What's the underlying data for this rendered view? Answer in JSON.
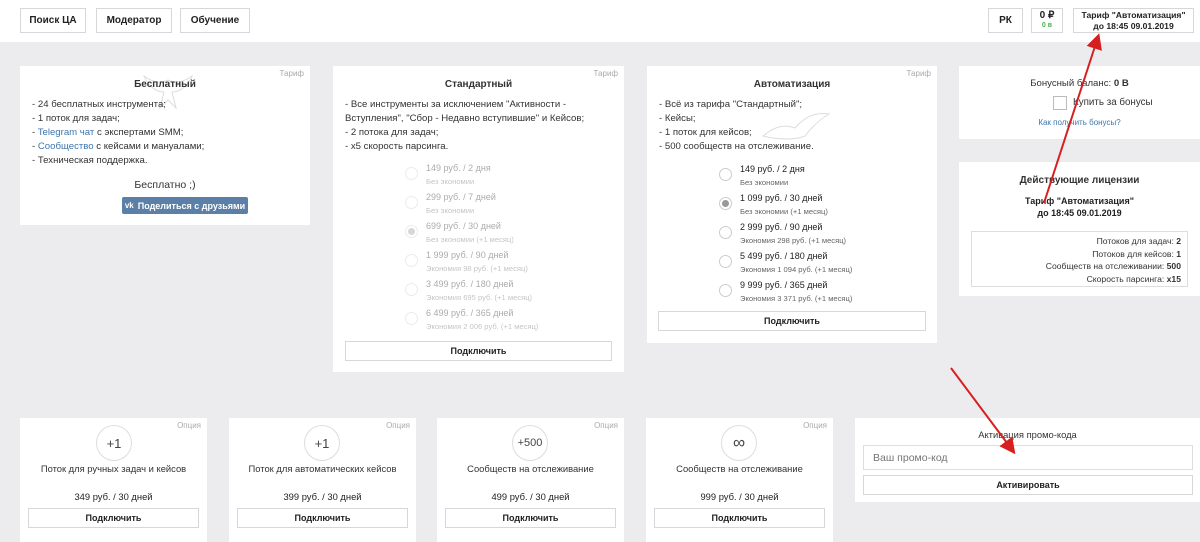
{
  "top_nav": {
    "search_ca": "Поиск ЦА",
    "moderator": "Модератор",
    "learning": "Обучение",
    "rk": "РК",
    "balance_amount": "0 ₽",
    "balance_bonus": "0 в",
    "tariff_name": "Тариф \"Автоматизация\"",
    "tariff_until": "до 18:45 09.01.2019"
  },
  "tariff_tag": "Тариф",
  "option_tag": "Опция",
  "connect_label": "Подключить",
  "free_plan": {
    "title": "Бесплатный",
    "line1": "- 24 бесплатных инструмента;",
    "line2": "- 1 поток для задач;",
    "line3_pre": "- ",
    "line3_link": "Telegram чат",
    "line3_post": " с экспертами SMM;",
    "line4_pre": "- ",
    "line4_link": "Сообщество",
    "line4_post": " с кейсами и мануалами;",
    "line5": "- Техническая поддержка.",
    "price": "Бесплатно ;)",
    "share_label": "Поделиться с друзьями",
    "share_icon": "vk-icon"
  },
  "standard_plan": {
    "title": "Стандартный",
    "lines": [
      "- Все инструменты за исключением \"Активности -",
      "Вступления\", \"Сбор - Недавно вступившие\" и Кейсов;",
      "- 2 потока для задач;",
      "- x5 скорость парсинга."
    ],
    "options": [
      {
        "label": "149 руб. / 2 дня",
        "sub": "Без экономии"
      },
      {
        "label": "299 руб. / 7 дней",
        "sub": "Без экономии"
      },
      {
        "label": "699 руб. / 30 дней",
        "sub": "Без экономии (+1 месяц)"
      },
      {
        "label": "1 999 руб. / 90 дней",
        "sub": "Экономия 98 руб. (+1 месяц)"
      },
      {
        "label": "3 499 руб. / 180 дней",
        "sub": "Экономия 695 руб. (+1 месяц)"
      },
      {
        "label": "6 499 руб. / 365 дней",
        "sub": "Экономия 2 006 руб. (+1 месяц)"
      }
    ]
  },
  "auto_plan": {
    "title": "Автоматизация",
    "lines": [
      "- Всё из тарифа \"Стандартный\";",
      "- Кейсы;",
      "- 1 поток для кейсов;",
      "- 500 сообществ на отслеживание."
    ],
    "options": [
      {
        "label": "149 руб. / 2 дня",
        "sub": "Без экономии"
      },
      {
        "label": "1 099 руб. / 30 дней",
        "sub": "Без экономии (+1 месяц)"
      },
      {
        "label": "2 999 руб. / 90 дней",
        "sub": "Экономия 298 руб. (+1 месяц)"
      },
      {
        "label": "5 499 руб. / 180 дней",
        "sub": "Экономия 1 094 руб. (+1 месяц)"
      },
      {
        "label": "9 999 руб. / 365 дней",
        "sub": "Экономия 3 371 руб. (+1 месяц)"
      }
    ]
  },
  "bonus": {
    "balance_label": "Бонусный баланс:",
    "balance_value": "0 В",
    "buy_label": "Купить за бонусы",
    "how_link": "Как получить бонусы?"
  },
  "licenses": {
    "title": "Действующие лицензии",
    "tariff": "Тариф \"Автоматизация\"",
    "until": "до 18:45 09.01.2019",
    "rows": [
      {
        "label": "Потоков для задач:",
        "value": "2"
      },
      {
        "label": "Потоков для кейсов:",
        "value": "1"
      },
      {
        "label": "Сообществ на отслеживании:",
        "value": "500"
      },
      {
        "label": "Скорость парсинга:",
        "value": "x15"
      }
    ]
  },
  "options": [
    {
      "icon": "+1",
      "name": "Поток для ручных задач и кейсов",
      "price": "349 руб. / 30 дней"
    },
    {
      "icon": "+1",
      "name": "Поток для автоматических кейсов",
      "price": "399 руб. / 30 дней"
    },
    {
      "icon": "+500",
      "name": "Сообществ на отслеживание",
      "price": "499 руб. / 30 дней"
    },
    {
      "icon": "∞",
      "name": "Сообществ на отслеживание",
      "price": "999 руб. / 30 дней"
    }
  ],
  "promo": {
    "title": "Активация промо-кода",
    "placeholder": "Ваш промо-код",
    "activate": "Активировать"
  },
  "colors": {
    "background": "#ececee",
    "link": "#3d76ad",
    "vk_button": "#5b7fa6",
    "bonus_green": "#4caf50",
    "arrow": "#d62020"
  }
}
